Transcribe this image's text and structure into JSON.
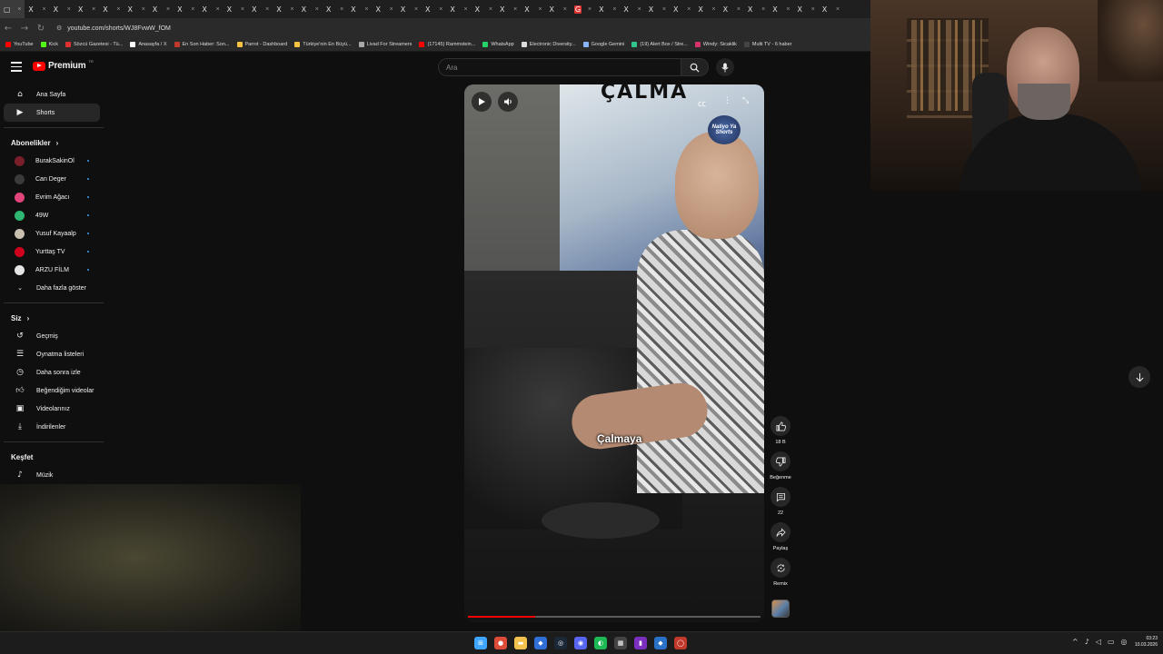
{
  "browser": {
    "tab_count": 34,
    "url": "youtube.com/shorts/WJ8FvwW_fOM",
    "bookmarks": [
      {
        "label": "YouTube",
        "color": "#ff0000"
      },
      {
        "label": "Kick",
        "color": "#53fc18"
      },
      {
        "label": "Sözcü Gazetesi - Tü...",
        "color": "#e03030"
      },
      {
        "label": "Anasayfa / X",
        "color": "#ffffff"
      },
      {
        "label": "En Son Haber: Son...",
        "color": "#c0392b"
      },
      {
        "label": "Parrot - Dashboard",
        "color": "#f5c242"
      },
      {
        "label": "Türkiye'nin En Büyü...",
        "color": "#f5c242"
      },
      {
        "label": "Livad For Streamers",
        "color": "#aaaaaa"
      },
      {
        "label": "(17145) Rammstein...",
        "color": "#ff0000"
      },
      {
        "label": "WhatsApp",
        "color": "#25d366"
      },
      {
        "label": "Electronic Diversity...",
        "color": "#dddddd"
      },
      {
        "label": "Google Gemini",
        "color": "#8ab4f8"
      },
      {
        "label": "(19) Alert Box / Stre...",
        "color": "#31c48d"
      },
      {
        "label": "Windy: Sicaklik",
        "color": "#d6336c"
      },
      {
        "label": "Multi TV - 6 haber",
        "color": "#444444"
      }
    ]
  },
  "header": {
    "logo_text": "Premium",
    "logo_tm": "TR",
    "search_placeholder": "Ara"
  },
  "sidebar": {
    "main": [
      {
        "label": "Ana Sayfa",
        "icon": "home-icon"
      },
      {
        "label": "Shorts",
        "icon": "shorts-icon",
        "active": true
      }
    ],
    "subscriptions_title": "Abonelikler",
    "subscriptions": [
      {
        "label": "BurakSakinOl",
        "color": "#7a1f2a"
      },
      {
        "label": "Can Deger",
        "color": "#3a3a3a"
      },
      {
        "label": "Evrim Ağacı",
        "color": "#e0457b"
      },
      {
        "label": "49W",
        "color": "#2fb673"
      },
      {
        "label": "Yusuf Kayaalp",
        "color": "#c9c0b0"
      },
      {
        "label": "Yurttaş TV",
        "color": "#d0021b"
      },
      {
        "label": "ARZU FİLM",
        "color": "#e5e5e5"
      }
    ],
    "show_more": "Daha fazla göster",
    "you_title": "Siz",
    "you": [
      {
        "label": "Geçmiş",
        "icon": "history-icon"
      },
      {
        "label": "Oynatma listeleri",
        "icon": "playlist-icon"
      },
      {
        "label": "Daha sonra izle",
        "icon": "clock-icon"
      },
      {
        "label": "Beğendiğim videolar",
        "icon": "thumbs-up-icon"
      },
      {
        "label": "Videolarınız",
        "icon": "video-icon"
      },
      {
        "label": "İndirilenler",
        "icon": "download-icon"
      }
    ],
    "explore_title": "Keşfet",
    "explore": [
      {
        "label": "Müzik",
        "icon": "music-icon"
      }
    ]
  },
  "short": {
    "caption": "Çalmaya",
    "channel_logo_text": "Naliyo Ya Shorts",
    "top_overlay_text": "ÇALMA",
    "progress_fraction": 0.23
  },
  "actions": {
    "like_count": "18 B",
    "dislike_label": "Beğenme",
    "comment_count": "22",
    "share_label": "Paylaş",
    "remix_label": "Remix"
  },
  "taskbar": {
    "time": "03:23",
    "date": "10.03.2026",
    "apps": [
      {
        "name": "windows-start-icon",
        "color": "#3ea6ff",
        "glyph": "⊞"
      },
      {
        "name": "chrome-icon",
        "color": "#dd4b39",
        "glyph": "●"
      },
      {
        "name": "file-explorer-icon",
        "color": "#f2c14e",
        "glyph": "▬"
      },
      {
        "name": "app-blue-icon",
        "color": "#2f6fd6",
        "glyph": "◆"
      },
      {
        "name": "steam-icon",
        "color": "#1b2838",
        "glyph": "◎"
      },
      {
        "name": "discord-icon",
        "color": "#5865f2",
        "glyph": "◉"
      },
      {
        "name": "spotify-icon",
        "color": "#1db954",
        "glyph": "◐"
      },
      {
        "name": "calculator-icon",
        "color": "#444444",
        "glyph": "▦"
      },
      {
        "name": "app-purple-icon",
        "color": "#7b2fbe",
        "glyph": "▮"
      },
      {
        "name": "app-bluish-icon",
        "color": "#2a72c7",
        "glyph": "◆"
      },
      {
        "name": "app-red-icon",
        "color": "#c0392b",
        "glyph": "◯"
      }
    ]
  }
}
